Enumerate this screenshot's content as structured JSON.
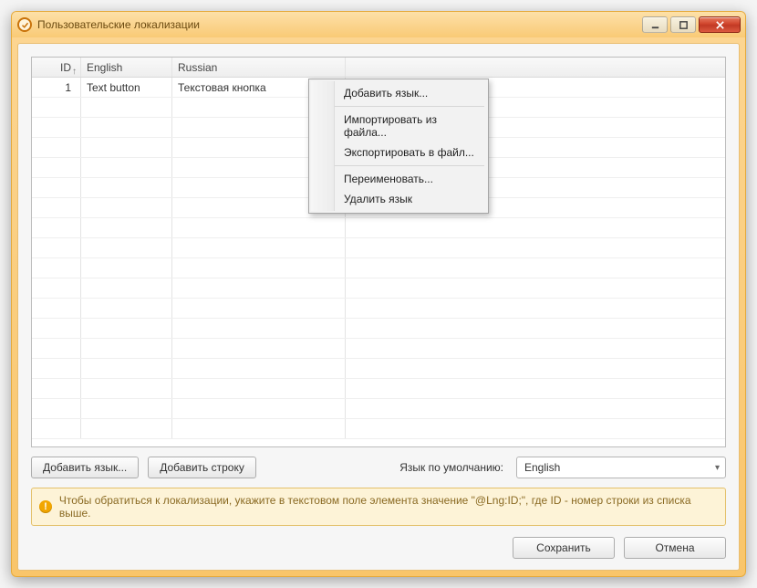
{
  "window": {
    "title": "Пользовательские локализации"
  },
  "grid": {
    "headers": {
      "id": "ID",
      "col1": "English",
      "col2": "Russian"
    },
    "sort_indicator": "↑",
    "rows": [
      {
        "id": "1",
        "col1": "Text button",
        "col2": "Текстовая кнопка"
      }
    ],
    "empty_row_count": 17
  },
  "context_menu": {
    "items": [
      {
        "label": "Добавить язык..."
      },
      {
        "sep": true
      },
      {
        "label": "Импортировать из файла..."
      },
      {
        "label": "Экспортировать в файл..."
      },
      {
        "sep": true
      },
      {
        "label": "Переименовать..."
      },
      {
        "label": "Удалить язык"
      }
    ]
  },
  "toolbar": {
    "add_lang": "Добавить язык...",
    "add_row": "Добавить строку",
    "default_lang_label": "Язык по умолчанию:",
    "default_lang_value": "English"
  },
  "hint": {
    "text": "Чтобы обратиться к локализации, укажите в текстовом поле элемента значение \"@Lng:ID;\", где ID - номер строки из списка выше."
  },
  "footer": {
    "save": "Сохранить",
    "cancel": "Отмена"
  }
}
